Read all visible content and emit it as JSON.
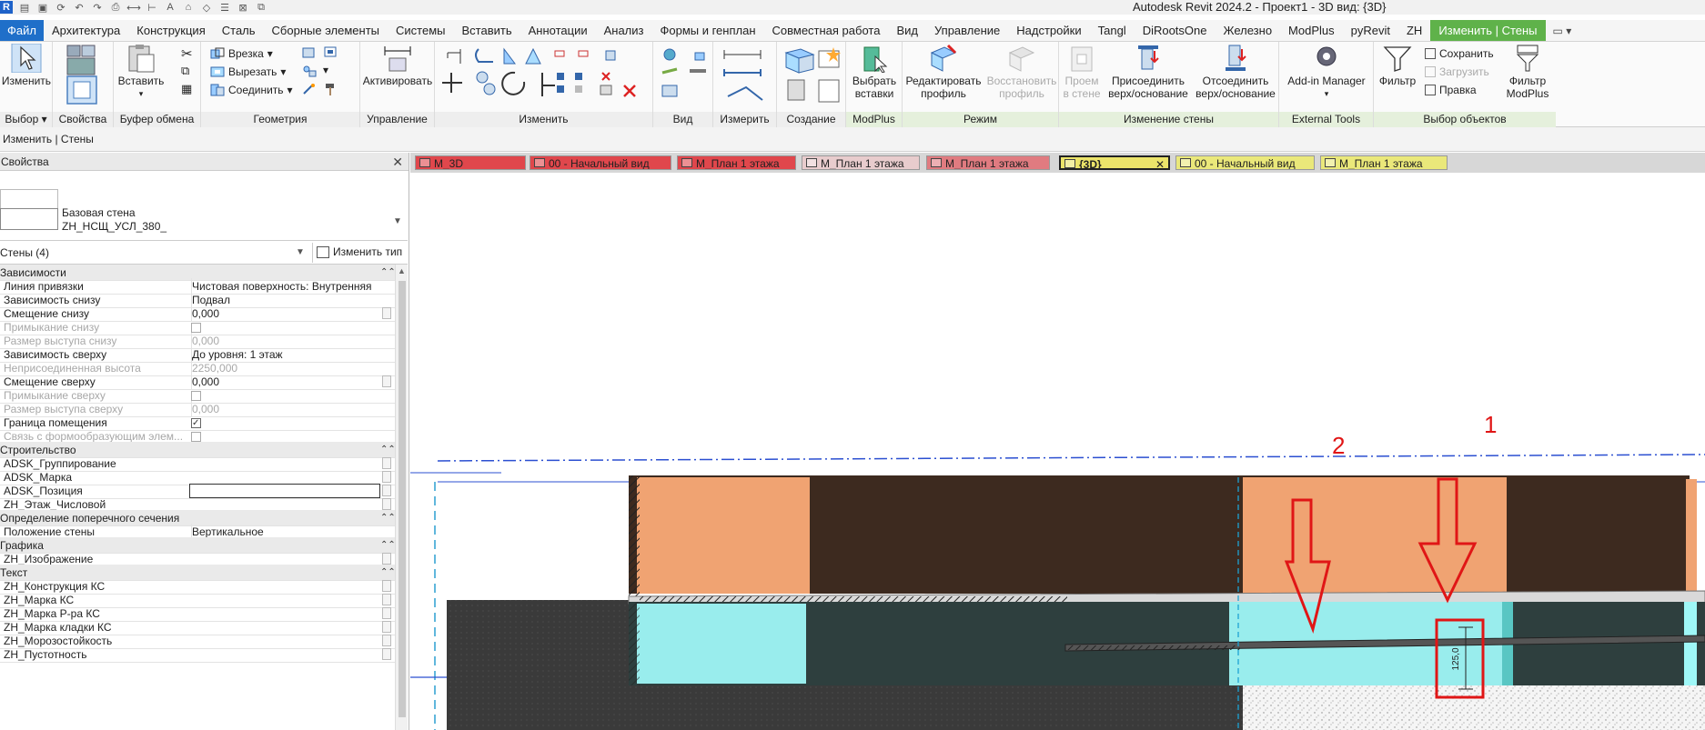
{
  "window": {
    "title": "Autodesk Revit 2024.2 - Проект1 - 3D вид: {3D}",
    "logo": "R"
  },
  "ribbon_tabs": [
    {
      "label": "Файл"
    },
    {
      "label": "Архитектура"
    },
    {
      "label": "Конструкция"
    },
    {
      "label": "Сталь"
    },
    {
      "label": "Сборные элементы"
    },
    {
      "label": "Системы"
    },
    {
      "label": "Вставить"
    },
    {
      "label": "Аннотации"
    },
    {
      "label": "Анализ"
    },
    {
      "label": "Формы и генплан"
    },
    {
      "label": "Совместная работа"
    },
    {
      "label": "Вид"
    },
    {
      "label": "Управление"
    },
    {
      "label": "Надстройки"
    },
    {
      "label": "Tangl"
    },
    {
      "label": "DiRootsOne"
    },
    {
      "label": "Железно"
    },
    {
      "label": "ModPlus"
    },
    {
      "label": "pyRevit"
    },
    {
      "label": "ZH"
    },
    {
      "label": "Изменить | Стены"
    }
  ],
  "ribbon": {
    "select": {
      "btn": "Изменить",
      "label": "Выбор"
    },
    "properties": {
      "label": "Свойства"
    },
    "clipboard": {
      "paste": "Вставить",
      "label": "Буфер обмена"
    },
    "geometry": {
      "cut": "Врезка",
      "cutout": "Вырезать",
      "join": "Соединить",
      "label": "Геометрия"
    },
    "control": {
      "activate": "Активировать",
      "label": "Управление"
    },
    "modify": {
      "label": "Изменить"
    },
    "view": {
      "label": "Вид"
    },
    "measure": {
      "label": "Измерить"
    },
    "create": {
      "label": "Создание"
    },
    "modplus": {
      "btn_line1": "Выбрать",
      "btn_line2": "вставки",
      "label": "ModPlus"
    },
    "mode": {
      "edit1": "Редактировать",
      "edit2": "профиль",
      "restore1": "Восстановить",
      "restore2": "профиль",
      "label": "Режим"
    },
    "wall_change": {
      "opening1": "Проем",
      "opening2": "в стене",
      "attach1": "Присоединить",
      "attach2": "верх/основание",
      "detach1": "Отсоединить",
      "detach2": "верх/основание",
      "label": "Изменение стены"
    },
    "external": {
      "addin": "Add-in Manager",
      "label": "External Tools"
    },
    "selection": {
      "filter": "Фильтр",
      "save": "Сохранить",
      "load": "Загрузить",
      "edit": "Правка",
      "mp_filter1": "Фильтр",
      "mp_filter2": "ModPlus",
      "label": "Выбор объектов"
    }
  },
  "options_bar": {
    "text": "Изменить | Стены"
  },
  "properties": {
    "header": "Свойства",
    "type_name_1": "Базовая стена",
    "type_name_2": "ZH_НСЩ_УСЛ_380_",
    "filter": "Стены (4)",
    "edit_type": "Изменить тип",
    "rows": [
      {
        "kind": "group",
        "k": "Зависимости"
      },
      {
        "k": "Линия привязки",
        "v": "Чистовая поверхность: Внутренняя"
      },
      {
        "k": "Зависимость снизу",
        "v": "Подвал"
      },
      {
        "k": "Смещение снизу",
        "v": "0,000",
        "assoc": true
      },
      {
        "k": "Примыкание снизу",
        "cb": "off",
        "muted": true
      },
      {
        "k": "Размер выступа снизу",
        "v": "0,000",
        "muted": true
      },
      {
        "k": "Зависимость сверху",
        "v": "До уровня: 1 этаж"
      },
      {
        "k": "Неприсоединенная высота",
        "v": "2250,000",
        "muted": true
      },
      {
        "k": "Смещение сверху",
        "v": "0,000",
        "assoc": true
      },
      {
        "k": "Примыкание сверху",
        "cb": "off",
        "muted": true
      },
      {
        "k": "Размер выступа сверху",
        "v": "0,000",
        "muted": true
      },
      {
        "k": "Граница помещения",
        "cb": "on"
      },
      {
        "k": "Связь с формообразующим элем...",
        "cb": "off",
        "muted": true
      },
      {
        "kind": "group",
        "k": "Строительство"
      },
      {
        "k": "ADSK_Группирование",
        "v": "",
        "assoc": true
      },
      {
        "k": "ADSK_Марка",
        "v": "",
        "assoc": true
      },
      {
        "k": "ADSK_Позиция",
        "input": true,
        "assoc": true
      },
      {
        "k": "ZH_Этаж_Числовой",
        "v": "",
        "assoc": true
      },
      {
        "kind": "group",
        "k": "Определение поперечного сечения"
      },
      {
        "k": "Положение стены",
        "v": "Вертикальное"
      },
      {
        "kind": "group",
        "k": "Графика"
      },
      {
        "k": "ZH_Изображение",
        "v": "",
        "assoc": true
      },
      {
        "kind": "group",
        "k": "Текст"
      },
      {
        "k": "ZH_Конструкция КС",
        "v": "",
        "assoc": true
      },
      {
        "k": "ZH_Марка КС",
        "v": "",
        "assoc": true
      },
      {
        "k": "ZH_Марка Р-ра КС",
        "v": "",
        "assoc": true
      },
      {
        "k": "ZH_Марка кладки КС",
        "v": "",
        "assoc": true
      },
      {
        "k": "ZH_Морозостойкость",
        "v": "",
        "assoc": true
      },
      {
        "k": "ZH_Пустотность",
        "v": "",
        "assoc": true
      }
    ]
  },
  "view_tabs": [
    {
      "label": "М_3D",
      "color": "#e0474c"
    },
    {
      "label": "00 - Начальный вид",
      "color": "#e0474c"
    },
    {
      "label": "М_План 1 этажа",
      "color": "#e0474c"
    },
    {
      "label": "М_План 1 этажа",
      "color": "#e8cccd"
    },
    {
      "label": "М_План 1 этажа",
      "color": "#e07b80"
    },
    {
      "label": "{3D}",
      "color": "#ece46a",
      "active": true
    },
    {
      "label": "00 - Начальный вид",
      "color": "#eae87a"
    },
    {
      "label": "М_План 1 этажа",
      "color": "#eae87a"
    }
  ],
  "canvas": {
    "annotations": [
      {
        "label": "1"
      },
      {
        "label": "2"
      }
    ],
    "dimension_text": "125,0"
  }
}
